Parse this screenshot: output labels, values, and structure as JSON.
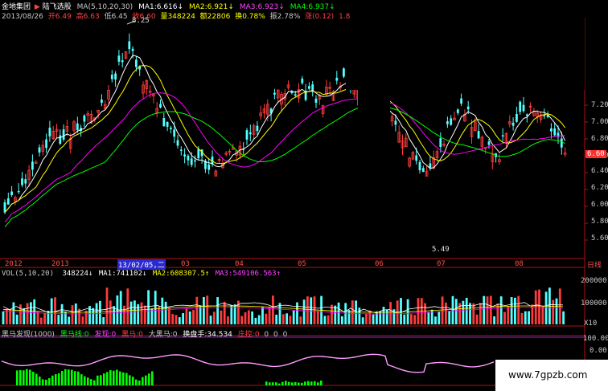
{
  "header": {
    "stock_name": "金地集团",
    "arrow": "▶",
    "sector": "陆飞选股",
    "ma_title": "MA(5,10,20,30)",
    "ma1": "MA1:6.616↓",
    "ma2": "MA2:6.921↓",
    "ma3": "MA3:6.923↓",
    "ma4": "MA4:6.937↓"
  },
  "quote": {
    "date": "2013/08/26",
    "open": "开6.49",
    "high": "高6.63",
    "low": "低6.45",
    "close": "收6.60",
    "volume": "量348224",
    "amount": "额22806",
    "turnover": "换0.78%",
    "amplitude": "振2.78%",
    "change": "涨(0.12)",
    "more": "1.8"
  },
  "price_axis": [
    "7.20",
    "7.00",
    "6.80",
    "6.60",
    "6.40",
    "6.20",
    "6.00",
    "5.80",
    "5.60"
  ],
  "last_price": "6.60",
  "annotations": {
    "high_mark": "8.25",
    "low_mark": "5.49"
  },
  "time_axis": {
    "labels": [
      "2012",
      "2013",
      "13/02/05,二",
      "03",
      "04",
      "05",
      "06",
      "07",
      "08"
    ],
    "period": "日线"
  },
  "volume_panel": {
    "title": "VOL(5,10,20)",
    "value": "348224↓",
    "ma1": "MA1:741102↓",
    "ma2": "MA2:608307.5↑",
    "ma3": "MA3:549106.563↑",
    "axis": [
      "200000",
      "100000"
    ],
    "unit": "X10"
  },
  "indicator_panel": {
    "title": "黑马发现(1000)",
    "items": [
      "黑马线:0",
      "发现:0",
      "黑马:0",
      "大黑马:0",
      "换盘手:34.534",
      "庄控:0",
      "0",
      "0",
      "0"
    ],
    "axis": [
      "100.00",
      "0.00"
    ]
  },
  "watermark": "www.7gpzb.com",
  "colors": {
    "up": "#ff3c3c",
    "down": "#54ffff",
    "ma1": "#ffffff",
    "ma2": "#ffff00",
    "ma3": "#ff00ff",
    "ma4": "#00ff00",
    "frame": "#b01010",
    "indicator_line": "#ff99ff",
    "histogram": "#00ff00"
  }
}
